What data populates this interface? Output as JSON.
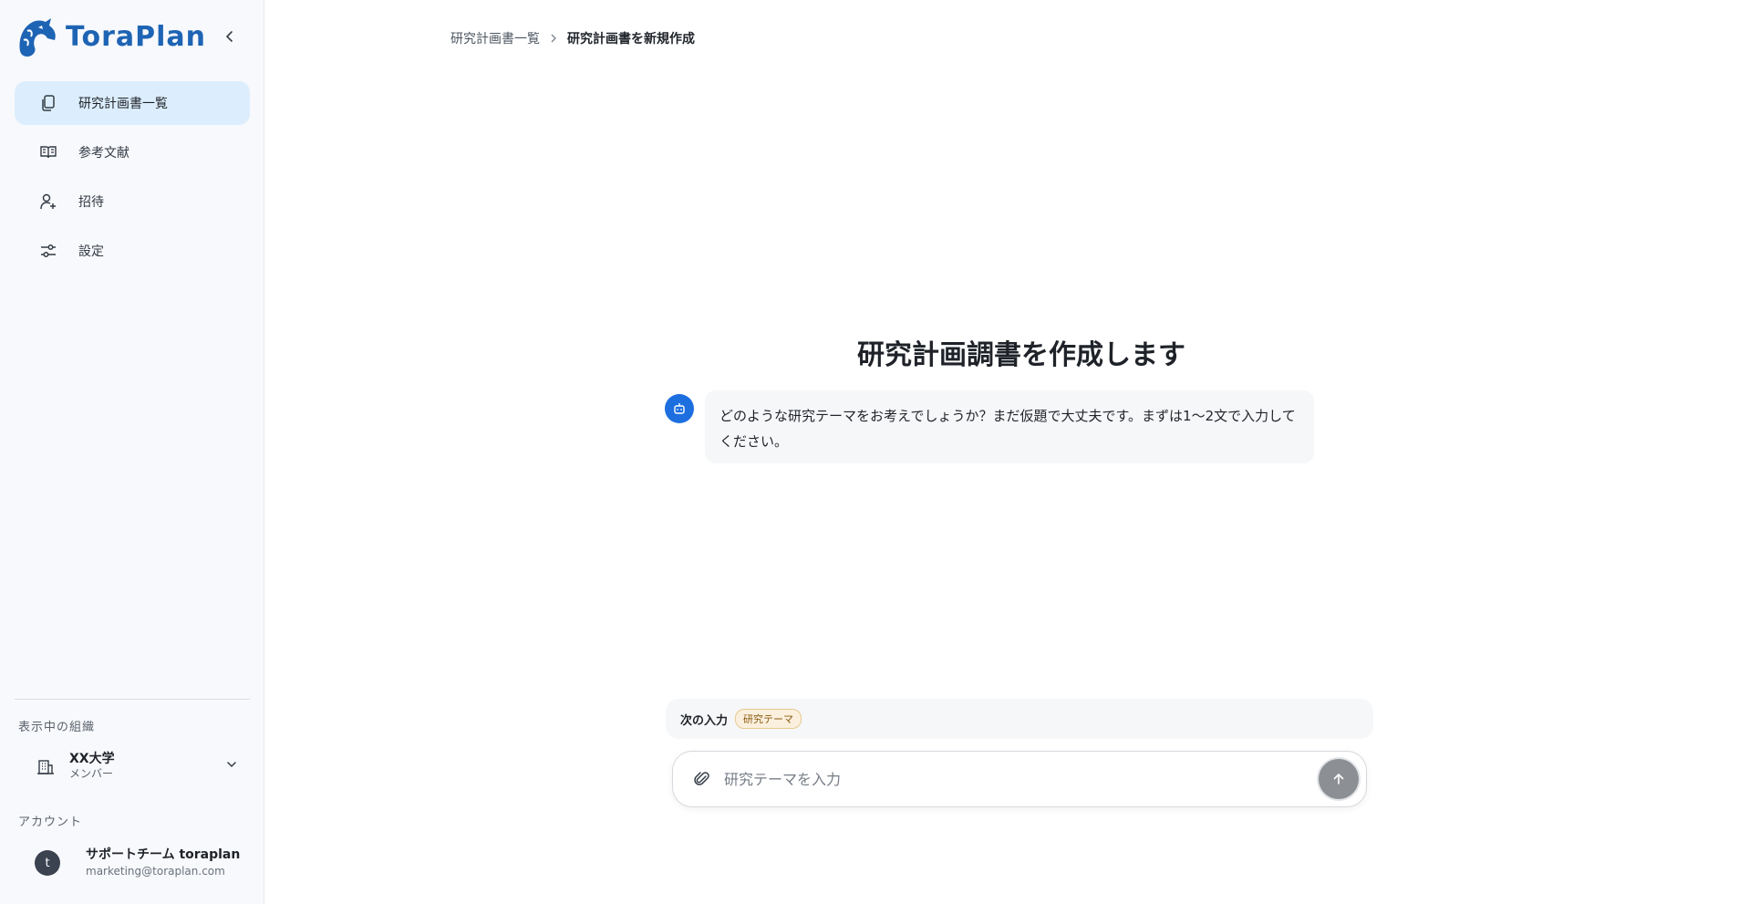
{
  "brand": {
    "name": "ToraPlan",
    "color": "#1e64b4"
  },
  "sidebar": {
    "items": [
      {
        "label": "研究計画書一覧",
        "icon": "documents-icon",
        "active": true
      },
      {
        "label": "参考文献",
        "icon": "book-open-icon",
        "active": false
      },
      {
        "label": "招待",
        "icon": "user-plus-icon",
        "active": false
      },
      {
        "label": "設定",
        "icon": "sliders-icon",
        "active": false
      }
    ],
    "org_section_label": "表示中の組織",
    "org": {
      "name": "XX大学",
      "role": "メンバー"
    },
    "account_section_label": "アカウント",
    "account": {
      "avatar_letter": "t",
      "name": "サポートチーム toraplan",
      "email": "marketing@toraplan.com"
    }
  },
  "breadcrumb": {
    "parent": "研究計画書一覧",
    "current": "研究計画書を新規作成"
  },
  "main": {
    "title": "研究計画調書を作成します",
    "bot_message": "どのような研究テーマをお考えでしょうか？まだ仮題で大丈夫です。まずは1〜2文で入力してください。"
  },
  "next_input": {
    "label": "次の入力",
    "tag": "研究テーマ"
  },
  "composer": {
    "placeholder": "研究テーマを入力",
    "value": ""
  },
  "colors": {
    "accent": "#1d6fe0",
    "active_nav_bg": "#dceefd",
    "send_disabled": "#8c8f94"
  }
}
